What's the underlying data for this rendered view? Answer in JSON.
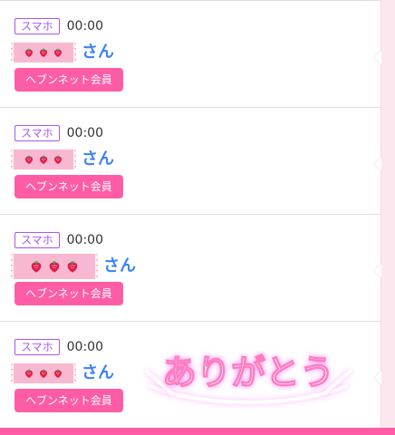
{
  "feed": {
    "entries": [
      {
        "device_tag": "スマホ",
        "time": "00:00",
        "name_suffix": "さん",
        "member_button_label": "ヘブンネット会員"
      },
      {
        "device_tag": "スマホ",
        "time": "00:00",
        "name_suffix": "さん",
        "member_button_label": "ヘブンネット会員"
      },
      {
        "device_tag": "スマホ",
        "time": "00:00",
        "name_suffix": "さん",
        "member_button_label": "ヘブンネット会員"
      },
      {
        "device_tag": "スマホ",
        "time": "00:00",
        "name_suffix": "さん",
        "member_button_label": "ヘブンネット会員",
        "stamp_text": "ありがとう"
      }
    ]
  },
  "icons": {
    "strawberry": "strawberry-icon"
  },
  "colors": {
    "accent_pink": "#ff5ca6",
    "device_tag_purple": "#a855f7",
    "name_blue": "#3b82f6",
    "tape_pink": "#f692b8",
    "rail_pink": "#fde7ee"
  }
}
